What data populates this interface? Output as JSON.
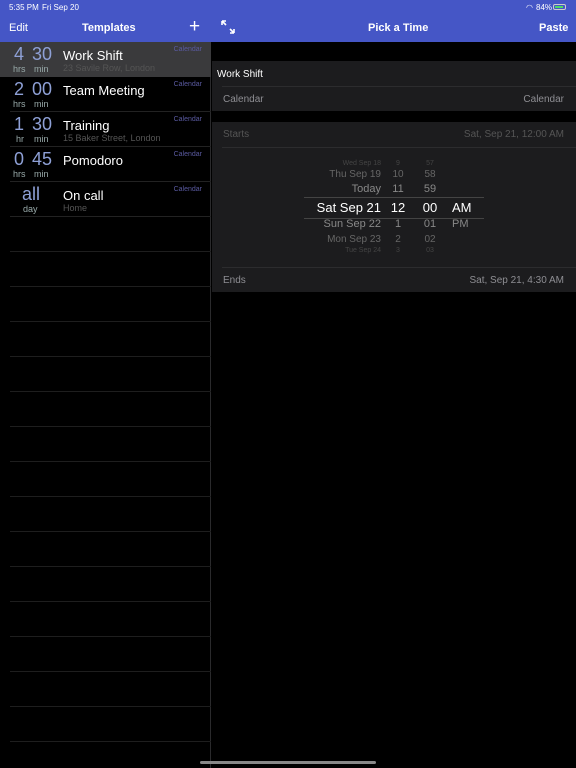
{
  "status": {
    "time": "5:35 PM",
    "date": "Fri Sep 20",
    "battery": "84%"
  },
  "left_nav": {
    "edit": "Edit",
    "title": "Templates",
    "add": "+"
  },
  "templates": [
    {
      "big1": "4",
      "unit1": "hrs",
      "big2": "30",
      "unit2": "min",
      "title": "Work Shift",
      "subtitle": "23 Savile Row, London",
      "calendar": "Calendar",
      "selected": true
    },
    {
      "big1": "2",
      "unit1": "hrs",
      "big2": "00",
      "unit2": "min",
      "title": "Team Meeting",
      "subtitle": "",
      "calendar": "Calendar"
    },
    {
      "big1": "1",
      "unit1": "hr",
      "big2": "30",
      "unit2": "min",
      "title": "Training",
      "subtitle": "15 Baker Street, London",
      "calendar": "Calendar"
    },
    {
      "big1": "0",
      "unit1": "hrs",
      "big2": "45",
      "unit2": "min",
      "title": "Pomodoro",
      "subtitle": "",
      "calendar": "Calendar"
    },
    {
      "allday": "all",
      "allday_unit": "day",
      "title": "On call",
      "subtitle": "Home",
      "calendar": "Calendar"
    }
  ],
  "right_nav": {
    "title": "Pick a Time",
    "paste": "Paste",
    "expand_icon": "expand-arrows-icon"
  },
  "detail": {
    "name": "Work Shift",
    "calendar_label": "Calendar",
    "calendar_value": "Calendar",
    "starts_label": "Starts",
    "starts_value": "Sat, Sep 21, 12:00 AM",
    "ends_label": "Ends",
    "ends_value": "Sat, Sep 21, 4:30 AM"
  },
  "picker": {
    "dates": [
      "Wed Sep 18",
      "Thu Sep 19",
      "Today",
      "Sat Sep 21",
      "Sun Sep 22",
      "Mon Sep 23",
      "Tue Sep 24"
    ],
    "hours": [
      "9",
      "10",
      "11",
      "12",
      "1",
      "2",
      "3"
    ],
    "minutes": [
      "57",
      "58",
      "59",
      "00",
      "01",
      "02",
      "03"
    ],
    "ampm": [
      "AM",
      "PM"
    ]
  },
  "colors": {
    "accent": "#4556c6"
  }
}
